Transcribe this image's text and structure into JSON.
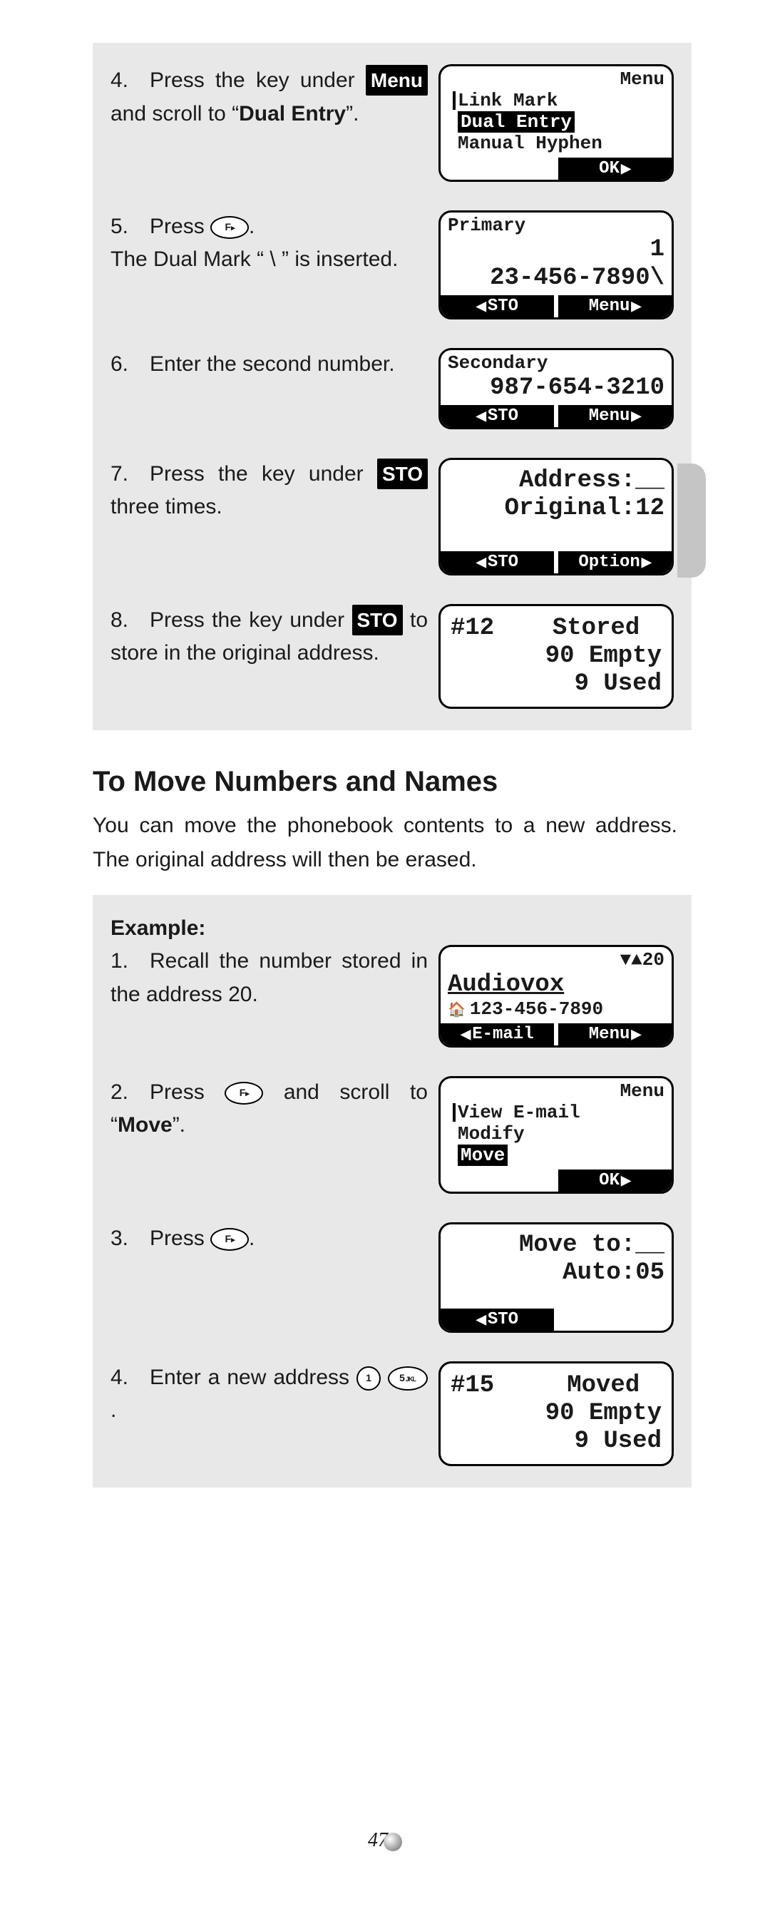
{
  "page_number": "47",
  "section1": {
    "step4": {
      "pre": "4. Press the key under ",
      "key": "Menu",
      "post1": " and scroll to “",
      "bold": "Dual Entry",
      "post2": "”."
    },
    "screen4": {
      "top_right": "Menu",
      "l1": "Link Mark",
      "l2": "Dual Entry",
      "l3": "Manual Hyphen",
      "soft_right": "OK"
    },
    "step5": {
      "pre": "5. Press ",
      "post": ".",
      "line2": "The Dual Mark “ \\ ” is inserted."
    },
    "screen5": {
      "title": "Primary",
      "n1": "1",
      "n2": "23-456-7890\\",
      "soft_left": "STO",
      "soft_right": "Menu"
    },
    "step6": {
      "text": "6. Enter the second number."
    },
    "screen6": {
      "title": "Secondary",
      "n1": "",
      "n2": "987-654-3210",
      "soft_left": "STO",
      "soft_right": "Menu"
    },
    "step7": {
      "pre": "7. Press the key under ",
      "key": "STO",
      "post": " three times."
    },
    "screen7": {
      "l1": "Address:__",
      "l2": "Original:12",
      "soft_left": "STO",
      "soft_right": "Option"
    },
    "step8": {
      "pre": "8. Press the key under ",
      "key": "STO",
      "post": " to store in the original address."
    },
    "screen8": {
      "l1": "#12    Stored",
      "l2": " 90 Empty",
      "l3": "  9 Used"
    }
  },
  "heading": "To Move Numbers and Names",
  "intro": "You can move the phonebook contents to a new address.  The original address will then be erased.",
  "section2": {
    "example_label": "Example:",
    "step1": {
      "text": "1. Recall the number stored in the address 20."
    },
    "screen1": {
      "top_right": "▼▲20",
      "name": "Audiovox",
      "phone": "123-456-7890",
      "soft_left": "E-mail",
      "soft_right": "Menu"
    },
    "step2": {
      "pre": "2. Press ",
      "mid": " and scroll to “",
      "bold": "Move",
      "post": "”."
    },
    "screen2": {
      "top_right": "Menu",
      "l1": "View E-mail",
      "l2": "Modify",
      "l3": "Move",
      "soft_right": "OK"
    },
    "step3": {
      "pre": "3. Press ",
      "post": "."
    },
    "screen3": {
      "l1": "Move to:__",
      "l2": "Auto:05",
      "soft_left": "STO"
    },
    "step4b": {
      "pre": "4. Enter a new address ",
      "key1": "1",
      "key5": "5",
      "key5sub": "JKL",
      "post": "."
    },
    "screen4b": {
      "l1": "#15     Moved",
      "l2": " 90 Empty",
      "l3": "  9 Used"
    }
  }
}
